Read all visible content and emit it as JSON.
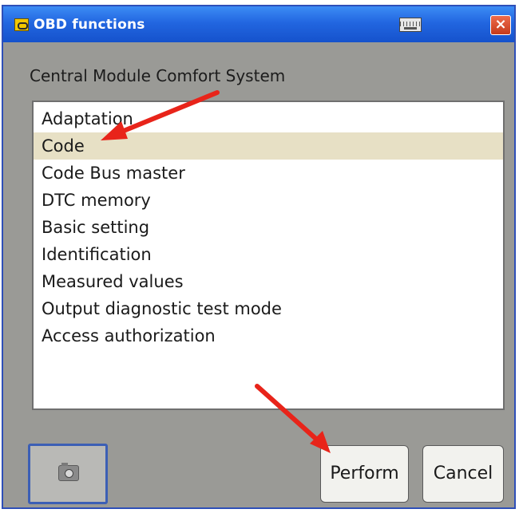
{
  "window": {
    "title": "OBD functions",
    "close_glyph": "×",
    "icons": [
      "app-icon",
      "keyboard-icon",
      "close-icon"
    ]
  },
  "module": {
    "heading": "Central Module Comfort System"
  },
  "functions": {
    "items": [
      "Adaptation",
      "Code",
      "Code Bus master",
      "DTC memory",
      "Basic setting",
      "Identification",
      "Measured values",
      "Output diagnostic test mode",
      "Access authorization"
    ],
    "selected": "Code"
  },
  "buttons": {
    "screenshot_icon": "camera-icon",
    "perform": "Perform",
    "cancel": "Cancel"
  },
  "colors": {
    "titlebar": "#2266e0",
    "window_bg": "#9a9a96",
    "selection": "#e7e0c5",
    "annotation_arrow": "#e8241a"
  }
}
